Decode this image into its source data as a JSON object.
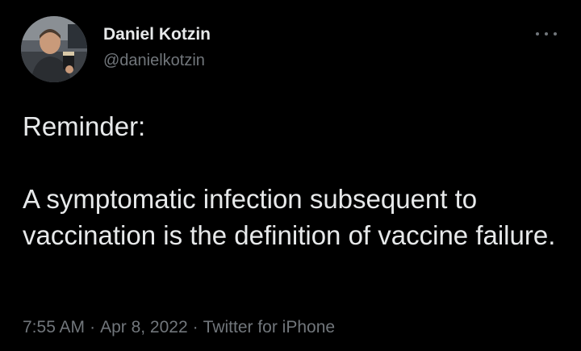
{
  "author": {
    "display_name": "Daniel Kotzin",
    "handle": "@danielkotzin",
    "avatar_icon": "user-avatar-photo"
  },
  "tweet": {
    "line1": "Reminder:",
    "line2": "A symptomatic infection subsequent to vaccination is the definition of vaccine failure."
  },
  "meta": {
    "time": "7:55 AM",
    "separator": "·",
    "date": "Apr 8, 2022",
    "source": "Twitter for iPhone"
  },
  "colors": {
    "background": "#000000",
    "primary_text": "#e7e9ea",
    "secondary_text": "#71767b"
  },
  "icons": {
    "more": "more-horizontal-icon"
  }
}
